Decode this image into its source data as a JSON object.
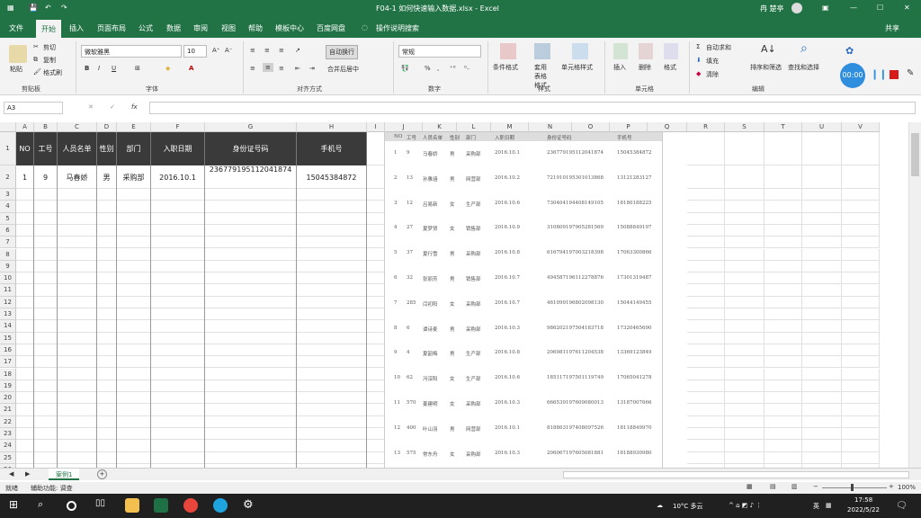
{
  "window": {
    "title": "F04-1 如何快速输入数据.xlsx - Excel",
    "user": "冉 楚亭"
  },
  "tabs": [
    "文件",
    "开始",
    "插入",
    "页面布局",
    "公式",
    "数据",
    "审阅",
    "视图",
    "帮助",
    "模板中心",
    "百度网盘",
    "操作说明搜索"
  ],
  "share": "共享",
  "ribbon": {
    "clipboard": {
      "paste": "粘贴",
      "cut": "剪切",
      "copy": "复制",
      "format_painter": "格式刷",
      "label": "剪贴板"
    },
    "font": {
      "name": "微软雅黑",
      "size": "10",
      "label": "字体"
    },
    "alignment": {
      "wrap": "自动换行",
      "merge": "合并后居中",
      "label": "对齐方式"
    },
    "number": {
      "format": "常规",
      "label": "数字"
    },
    "styles": {
      "cond": "条件格式",
      "table": "套用表格格式",
      "cell": "单元格样式",
      "label": "样式"
    },
    "cells": {
      "insert": "插入",
      "delete": "删除",
      "format": "格式",
      "label": "单元格"
    },
    "editing": {
      "autosum": "自动求和",
      "fill": "填充",
      "clear": "清除",
      "sort": "排序和筛选",
      "find": "查找和选择",
      "label": "编辑"
    },
    "timer": "00:00"
  },
  "namebox": "A3",
  "formula_icons": {
    "cancel": "✕",
    "enter": "✓",
    "fx": "fx"
  },
  "columns": [
    "A",
    "B",
    "C",
    "D",
    "E",
    "F",
    "G",
    "H",
    "I",
    "J",
    "K",
    "L",
    "M",
    "N",
    "O",
    "P",
    "Q",
    "R",
    "S",
    "T",
    "U",
    "V"
  ],
  "rows": [
    "1",
    "2",
    "3",
    "4",
    "5",
    "6",
    "7",
    "8",
    "9",
    "10",
    "11",
    "12",
    "13",
    "14",
    "15",
    "16",
    "17",
    "18",
    "19",
    "20",
    "21",
    "22",
    "23",
    "24",
    "25",
    "26"
  ],
  "table": {
    "headers": [
      "NO",
      "工号",
      "人员名单",
      "性别",
      "部门",
      "入职日期",
      "身份证号码",
      "手机号"
    ],
    "row1": [
      "1",
      "9",
      "马春娇",
      "男",
      "采购部",
      "2016.10.1",
      "236779195112041874",
      "15045384872"
    ]
  },
  "image": {
    "headers": [
      "NO",
      "工号",
      "人员名单",
      "性别",
      "部门",
      "入职日期",
      "身份证号码",
      "手机号"
    ],
    "rows": [
      [
        "1",
        "9",
        "马春娇",
        "男",
        "采购部",
        "2016.10.1",
        "236779195112041874",
        "15045384872"
      ],
      [
        "2",
        "13",
        "孙雅涵",
        "男",
        "网营部",
        "2016.10.2",
        "721910195301013868",
        "13121283127"
      ],
      [
        "3",
        "12",
        "吕易新",
        "女",
        "生产部",
        "2016.10.6",
        "730404194408149105",
        "18180188225"
      ],
      [
        "4",
        "27",
        "夏梦贤",
        "女",
        "销售部",
        "2016.10.9",
        "310809197905281569",
        "15088849197"
      ],
      [
        "5",
        "37",
        "夏行雪",
        "男",
        "采购部",
        "2016.10.8",
        "616794197003218398",
        "17063300866"
      ],
      [
        "6",
        "32",
        "张丽芳",
        "男",
        "销售部",
        "2016.10.7",
        "494587196112278876",
        "17301319487"
      ],
      [
        "7",
        "285",
        "闫初阳",
        "女",
        "采购部",
        "2016.10.7",
        "461099196802098130",
        "15044149455"
      ],
      [
        "8",
        "6",
        "谭诗麦",
        "男",
        "采购部",
        "2016.10.3",
        "986202197504183718",
        "17320465690"
      ],
      [
        "9",
        "4",
        "夏韶梅",
        "男",
        "生产部",
        "2016.10.8",
        "206981197611204538",
        "13369123849"
      ],
      [
        "10",
        "62",
        "冯淳阳",
        "女",
        "生产部",
        "2016.10.6",
        "185117197501119749",
        "17065041278"
      ],
      [
        "11",
        "570",
        "姜建明",
        "女",
        "采购部",
        "2016.10.3",
        "666539197609080013",
        "13187007666"
      ],
      [
        "12",
        "400",
        "叶山羽",
        "男",
        "网营部",
        "2016.10.1",
        "818863197408097526",
        "18118849970"
      ],
      [
        "13",
        "575",
        "常东舟",
        "女",
        "采购部",
        "2016.10.3",
        "206067197605081881",
        "18188930980"
      ]
    ]
  },
  "sheet_tab": "案例1",
  "status": {
    "ready": "就绪",
    "accessibility": "辅助功能: 调查",
    "zoom": "100%"
  },
  "taskbar": {
    "weather": "10°C 多云",
    "time": "17:58",
    "date": "2022/5/22",
    "ime": "英"
  }
}
